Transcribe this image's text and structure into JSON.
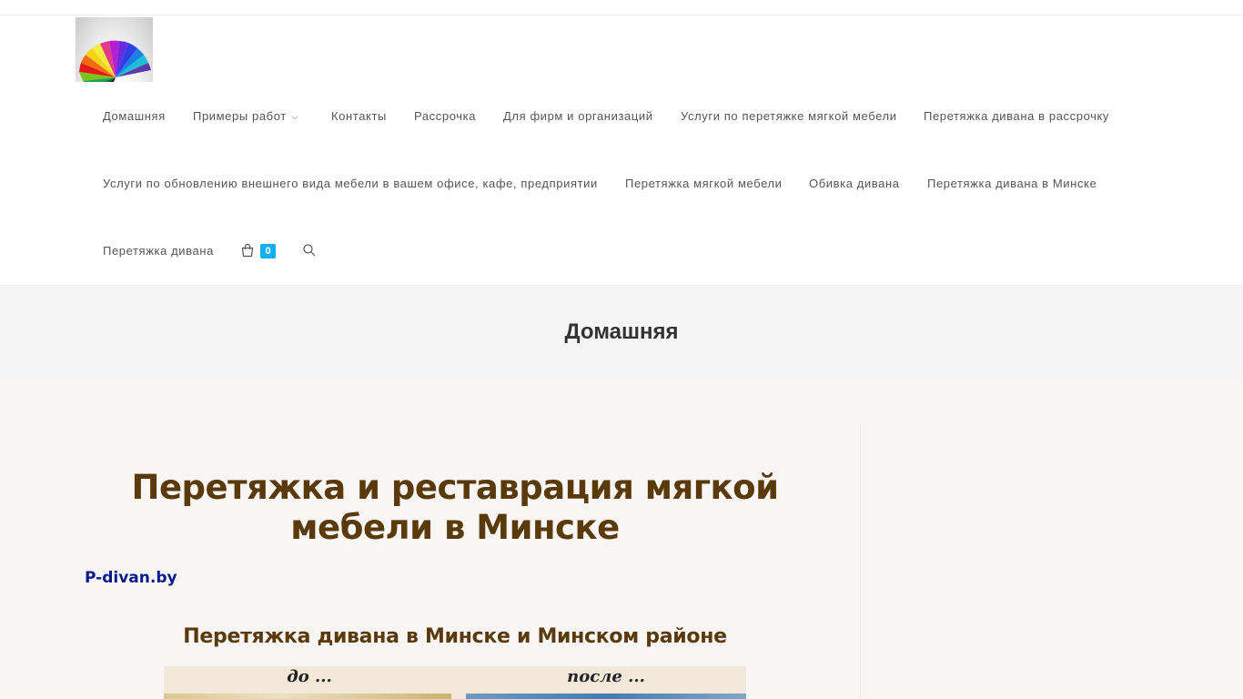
{
  "nav": {
    "items": [
      {
        "label": "Домашняя"
      },
      {
        "label": "Примеры работ",
        "has_submenu": true
      },
      {
        "label": "Контакты"
      },
      {
        "label": "Рассрочка"
      },
      {
        "label": "Для фирм и организаций"
      },
      {
        "label": "Услуги по перетяжке мягкой мебели"
      },
      {
        "label": "Перетяжка дивана в рассрочку"
      },
      {
        "label": "Услуги по обновлению внешнего вида мебели в вашем офисе, кафе, предприятии"
      },
      {
        "label": "Перетяжка мягкой мебели"
      },
      {
        "label": "Обивка дивана"
      },
      {
        "label": "Перетяжка дивана в Минске"
      },
      {
        "label": "Перетяжка дивана"
      }
    ],
    "cart_count": "0",
    "cart_icon": "shopping-bag-icon",
    "search_icon": "search-icon",
    "submenu_icon": "chevron-down-icon"
  },
  "page_title": "Домашняя",
  "content": {
    "heading": "Перетяжка и реставрация мягкой мебели в Минске",
    "site_link": "P-divan.by",
    "subheading": "Перетяжка дивана в Минске и Минском районе",
    "before_label": "до ...",
    "after_label": "после ..."
  },
  "colors": {
    "accent": "#13aff0",
    "heading": "#5a3a0a",
    "link": "#0a1a8a",
    "title_band": "#f5f5f5",
    "content_bg": "#f8f6f5"
  }
}
